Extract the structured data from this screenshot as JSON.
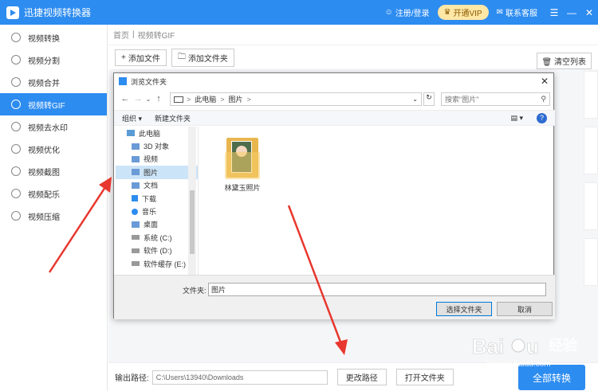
{
  "app": {
    "title": "迅捷视频转换器"
  },
  "titlebar": {
    "login": "注册/登录",
    "vip": "开通VIP",
    "support": "联系客服"
  },
  "sidebar": {
    "items": [
      {
        "label": "视频转换"
      },
      {
        "label": "视频分割"
      },
      {
        "label": "视频合并"
      },
      {
        "label": "视频转GIF",
        "active": true
      },
      {
        "label": "视频去水印"
      },
      {
        "label": "视频优化"
      },
      {
        "label": "视频截图"
      },
      {
        "label": "视频配乐"
      },
      {
        "label": "视频压缩"
      }
    ]
  },
  "breadcrumb": {
    "home": "首页",
    "sep": "|",
    "current": "视频转GIF"
  },
  "toolbar": {
    "add_file": "添加文件",
    "add_folder": "添加文件夹",
    "clear_list": "清空列表"
  },
  "bottom": {
    "output_label": "输出路径:",
    "output_path": "C:\\Users\\13940\\Downloads",
    "change_path": "更改路径",
    "open_folder": "打开文件夹",
    "convert_all": "全部转换"
  },
  "dialog": {
    "title": "浏览文件夹",
    "address": {
      "root": "此电脑",
      "sep1": ">",
      "folder": "图片",
      "sep2": ">"
    },
    "search_placeholder": "搜索\"图片\"",
    "organize": "组织 ▾",
    "new_folder": "新建文件夹",
    "tree": [
      {
        "label": "此电脑",
        "icon": "pc"
      },
      {
        "label": "3D 对象",
        "icon": "folder"
      },
      {
        "label": "视频",
        "icon": "folder"
      },
      {
        "label": "图片",
        "icon": "folder",
        "selected": true
      },
      {
        "label": "文档",
        "icon": "folder"
      },
      {
        "label": "下载",
        "icon": "download"
      },
      {
        "label": "音乐",
        "icon": "music"
      },
      {
        "label": "桌面",
        "icon": "folder"
      },
      {
        "label": "系统 (C:)",
        "icon": "drive"
      },
      {
        "label": "软件 (D:)",
        "icon": "drive"
      },
      {
        "label": "软件缓存 (E:)",
        "icon": "drive"
      }
    ],
    "files": [
      {
        "name": "林黛玉照片"
      }
    ],
    "filename_label": "文件夹:",
    "filename_value": "图片",
    "select_button": "选择文件夹",
    "cancel_button": "取消"
  },
  "watermark": {
    "brand_cn": "经验",
    "url": "jingyan.baidu.com"
  },
  "colors": {
    "accent": "#2d8cf0",
    "arrow": "#e8372e"
  }
}
